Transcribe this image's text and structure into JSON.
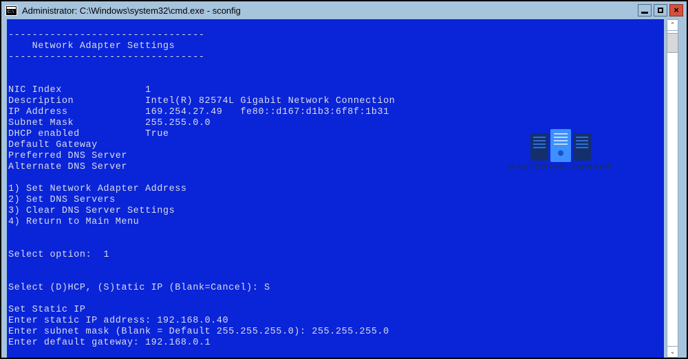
{
  "window": {
    "title": "Administrator: C:\\Windows\\system32\\cmd.exe - sconfig",
    "icon_name": "cmd-console-icon",
    "prompt_glyph": "C:\\",
    "titlebar_bg": "#a7c4dd",
    "console_bg": "#0a24d8",
    "console_fg": "#d8dde8",
    "close_bg": "#d8503c"
  },
  "titlebar_buttons": {
    "minimize": "–",
    "maximize": "□",
    "close": "×"
  },
  "scrollbar": {
    "up_arrow": "⌃",
    "down_arrow": "⌄"
  },
  "watermark": {
    "text": "MASTERING VMWARE",
    "icon_name": "server-rack-icon",
    "text_color": "#15306a",
    "tower_dark": "#13306c",
    "tower_light": "#3e8fff"
  },
  "console": {
    "lines": [
      "",
      "---------------------------------",
      "    Network Adapter Settings",
      "---------------------------------",
      "",
      "",
      "NIC Index              1",
      "Description            Intel(R) 82574L Gigabit Network Connection",
      "IP Address             169.254.27.49   fe80::d167:d1b3:6f8f:1b31",
      "Subnet Mask            255.255.0.0",
      "DHCP enabled           True",
      "Default Gateway",
      "Preferred DNS Server",
      "Alternate DNS Server",
      "",
      "1) Set Network Adapter Address",
      "2) Set DNS Servers",
      "3) Clear DNS Server Settings",
      "4) Return to Main Menu",
      "",
      "",
      "Select option:  1",
      "",
      "",
      "Select (D)HCP, (S)tatic IP (Blank=Cancel): S",
      "",
      "Set Static IP",
      "Enter static IP address: 192.168.0.40",
      "Enter subnet mask (Blank = Default 255.255.255.0): 255.255.255.0",
      "Enter default gateway: 192.168.0.1"
    ]
  }
}
